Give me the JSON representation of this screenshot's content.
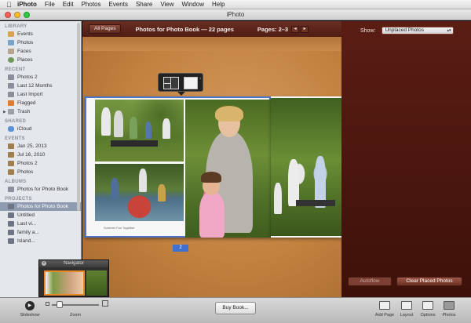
{
  "menubar": {
    "app": "iPhoto",
    "items": [
      "File",
      "Edit",
      "Photos",
      "Events",
      "Share",
      "View",
      "Window",
      "Help"
    ]
  },
  "window": {
    "title": "iPhoto"
  },
  "sidebar": {
    "library": {
      "heading": "LIBRARY",
      "items": [
        "Events",
        "Photos",
        "Faces",
        "Places"
      ]
    },
    "recent": {
      "heading": "RECENT",
      "items": [
        "Photos 2",
        "Last 12 Months",
        "Last Import",
        "Flagged",
        "Trash"
      ]
    },
    "shared": {
      "heading": "SHARED",
      "items": [
        "iCloud"
      ]
    },
    "events": {
      "heading": "EVENTS",
      "items": [
        "Jan 25, 2013",
        "Jul 16, 2010",
        "Photos 2",
        "Photos"
      ]
    },
    "albums": {
      "heading": "ALBUMS",
      "items": [
        "Photos for Photo Book"
      ]
    },
    "projects": {
      "heading": "PROJECTS",
      "items": [
        "Photos for Photo Book",
        "Untitled",
        "Last vi...",
        "family a...",
        "Island..."
      ]
    }
  },
  "toolbar": {
    "all_pages": "All Pages",
    "book_title": "Photos for Photo Book — 22 pages",
    "pages": "Pages: 2–3",
    "prev": "◂",
    "next": "▸"
  },
  "right_panel": {
    "show_label": "Show:",
    "show_value": "Unplaced Photos",
    "autoflow": "Autoflow",
    "clear": "Clear Placed Photos"
  },
  "canvas": {
    "caption": "Summer Fun Together",
    "page_number": "2",
    "layout_count": "1"
  },
  "navigator": {
    "title": "Navigator"
  },
  "bottom": {
    "slideshow": "Slideshow",
    "zoom": "Zoom",
    "buy_book": "Buy Book...",
    "add_page": "Add Page",
    "layout": "Layout",
    "options": "Options",
    "photos": "Photos"
  },
  "colors": {
    "accent_blue": "#4f76c6",
    "panel_red": "#5a1d14",
    "toolbar_red": "#4e1d15",
    "wood": "#c1813f"
  }
}
